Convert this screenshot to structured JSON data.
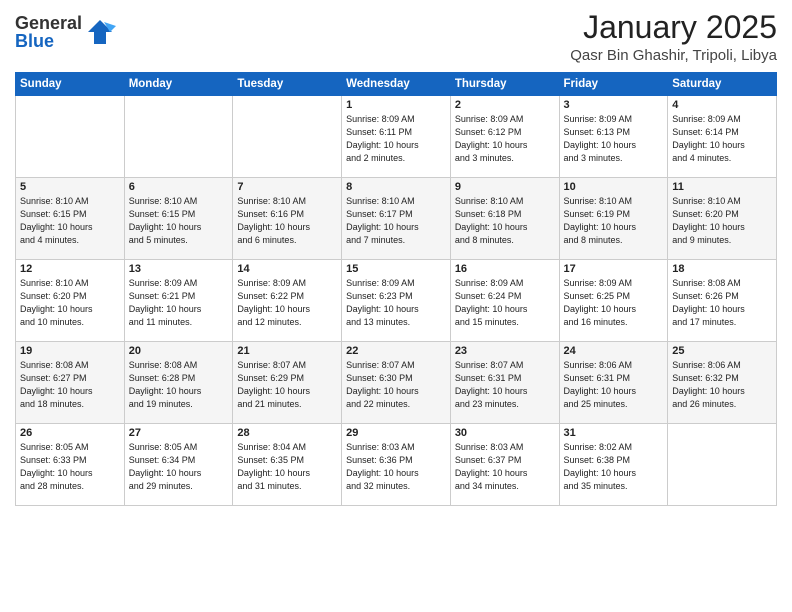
{
  "logo": {
    "general": "General",
    "blue": "Blue"
  },
  "header": {
    "title": "January 2025",
    "subtitle": "Qasr Bin Ghashir, Tripoli, Libya"
  },
  "weekdays": [
    "Sunday",
    "Monday",
    "Tuesday",
    "Wednesday",
    "Thursday",
    "Friday",
    "Saturday"
  ],
  "weeks": [
    [
      {
        "day": "",
        "info": ""
      },
      {
        "day": "",
        "info": ""
      },
      {
        "day": "",
        "info": ""
      },
      {
        "day": "1",
        "info": "Sunrise: 8:09 AM\nSunset: 6:11 PM\nDaylight: 10 hours\nand 2 minutes."
      },
      {
        "day": "2",
        "info": "Sunrise: 8:09 AM\nSunset: 6:12 PM\nDaylight: 10 hours\nand 3 minutes."
      },
      {
        "day": "3",
        "info": "Sunrise: 8:09 AM\nSunset: 6:13 PM\nDaylight: 10 hours\nand 3 minutes."
      },
      {
        "day": "4",
        "info": "Sunrise: 8:09 AM\nSunset: 6:14 PM\nDaylight: 10 hours\nand 4 minutes."
      }
    ],
    [
      {
        "day": "5",
        "info": "Sunrise: 8:10 AM\nSunset: 6:15 PM\nDaylight: 10 hours\nand 4 minutes."
      },
      {
        "day": "6",
        "info": "Sunrise: 8:10 AM\nSunset: 6:15 PM\nDaylight: 10 hours\nand 5 minutes."
      },
      {
        "day": "7",
        "info": "Sunrise: 8:10 AM\nSunset: 6:16 PM\nDaylight: 10 hours\nand 6 minutes."
      },
      {
        "day": "8",
        "info": "Sunrise: 8:10 AM\nSunset: 6:17 PM\nDaylight: 10 hours\nand 7 minutes."
      },
      {
        "day": "9",
        "info": "Sunrise: 8:10 AM\nSunset: 6:18 PM\nDaylight: 10 hours\nand 8 minutes."
      },
      {
        "day": "10",
        "info": "Sunrise: 8:10 AM\nSunset: 6:19 PM\nDaylight: 10 hours\nand 8 minutes."
      },
      {
        "day": "11",
        "info": "Sunrise: 8:10 AM\nSunset: 6:20 PM\nDaylight: 10 hours\nand 9 minutes."
      }
    ],
    [
      {
        "day": "12",
        "info": "Sunrise: 8:10 AM\nSunset: 6:20 PM\nDaylight: 10 hours\nand 10 minutes."
      },
      {
        "day": "13",
        "info": "Sunrise: 8:09 AM\nSunset: 6:21 PM\nDaylight: 10 hours\nand 11 minutes."
      },
      {
        "day": "14",
        "info": "Sunrise: 8:09 AM\nSunset: 6:22 PM\nDaylight: 10 hours\nand 12 minutes."
      },
      {
        "day": "15",
        "info": "Sunrise: 8:09 AM\nSunset: 6:23 PM\nDaylight: 10 hours\nand 13 minutes."
      },
      {
        "day": "16",
        "info": "Sunrise: 8:09 AM\nSunset: 6:24 PM\nDaylight: 10 hours\nand 15 minutes."
      },
      {
        "day": "17",
        "info": "Sunrise: 8:09 AM\nSunset: 6:25 PM\nDaylight: 10 hours\nand 16 minutes."
      },
      {
        "day": "18",
        "info": "Sunrise: 8:08 AM\nSunset: 6:26 PM\nDaylight: 10 hours\nand 17 minutes."
      }
    ],
    [
      {
        "day": "19",
        "info": "Sunrise: 8:08 AM\nSunset: 6:27 PM\nDaylight: 10 hours\nand 18 minutes."
      },
      {
        "day": "20",
        "info": "Sunrise: 8:08 AM\nSunset: 6:28 PM\nDaylight: 10 hours\nand 19 minutes."
      },
      {
        "day": "21",
        "info": "Sunrise: 8:07 AM\nSunset: 6:29 PM\nDaylight: 10 hours\nand 21 minutes."
      },
      {
        "day": "22",
        "info": "Sunrise: 8:07 AM\nSunset: 6:30 PM\nDaylight: 10 hours\nand 22 minutes."
      },
      {
        "day": "23",
        "info": "Sunrise: 8:07 AM\nSunset: 6:31 PM\nDaylight: 10 hours\nand 23 minutes."
      },
      {
        "day": "24",
        "info": "Sunrise: 8:06 AM\nSunset: 6:31 PM\nDaylight: 10 hours\nand 25 minutes."
      },
      {
        "day": "25",
        "info": "Sunrise: 8:06 AM\nSunset: 6:32 PM\nDaylight: 10 hours\nand 26 minutes."
      }
    ],
    [
      {
        "day": "26",
        "info": "Sunrise: 8:05 AM\nSunset: 6:33 PM\nDaylight: 10 hours\nand 28 minutes."
      },
      {
        "day": "27",
        "info": "Sunrise: 8:05 AM\nSunset: 6:34 PM\nDaylight: 10 hours\nand 29 minutes."
      },
      {
        "day": "28",
        "info": "Sunrise: 8:04 AM\nSunset: 6:35 PM\nDaylight: 10 hours\nand 31 minutes."
      },
      {
        "day": "29",
        "info": "Sunrise: 8:03 AM\nSunset: 6:36 PM\nDaylight: 10 hours\nand 32 minutes."
      },
      {
        "day": "30",
        "info": "Sunrise: 8:03 AM\nSunset: 6:37 PM\nDaylight: 10 hours\nand 34 minutes."
      },
      {
        "day": "31",
        "info": "Sunrise: 8:02 AM\nSunset: 6:38 PM\nDaylight: 10 hours\nand 35 minutes."
      },
      {
        "day": "",
        "info": ""
      }
    ]
  ]
}
